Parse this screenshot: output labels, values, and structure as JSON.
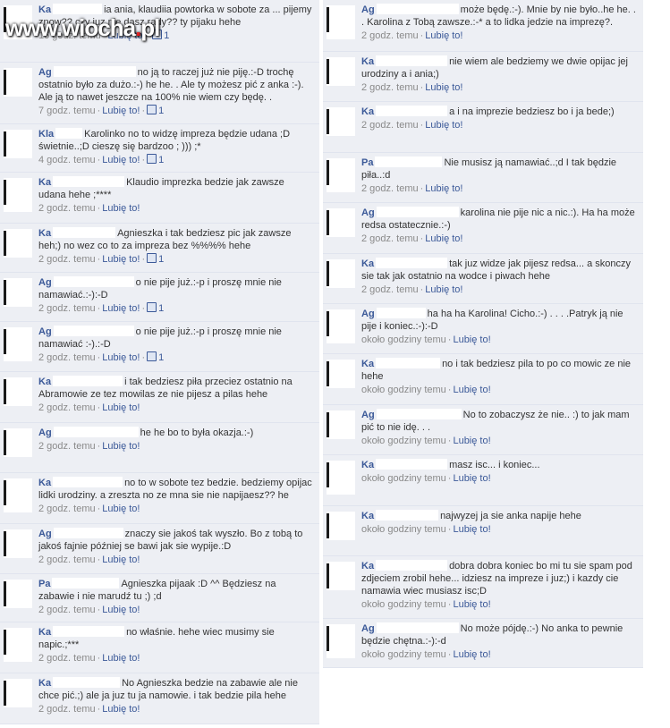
{
  "watermark": {
    "pre": "www.wiocha",
    "dot": ".",
    "tld": "pl"
  },
  "ui": {
    "like": "Lubię to!",
    "separator": "·"
  },
  "left_comments": [
    {
      "name": "Ka",
      "text": "ia ania, klaudiia powtorka w sobote za ... pijemy znow?? czy juz nie dasz rady?? ty pijaku hehe",
      "time": "16 godz. temu",
      "likes": "1"
    },
    {
      "name": "Ag",
      "text": "no ją to raczej już nie piję.:-D trochę ostatnio było za dużo.:-) he he. . Ale ty możesz pić z anka :-). Ale ją to nawet jeszcze na 100% nie wiem czy będę. .",
      "time": "7 godz. temu",
      "likes": "1"
    },
    {
      "name": "Kla",
      "text": "Karolinko no to widzę impreza będzie udana ;D świetnie..;D cieszę się bardzoo ; ))) ;*",
      "time": "4 godz. temu",
      "likes": "1"
    },
    {
      "name": "Ka",
      "text": "Klaudio imprezka bedzie jak zawsze udana hehe ;****",
      "time": "2 godz. temu",
      "likes": ""
    },
    {
      "name": "Ka",
      "text": "Agnieszka i tak bedziesz pic jak zawsze heh;) no wez co to za impreza bez %%%% hehe",
      "time": "2 godz. temu",
      "likes": "1"
    },
    {
      "name": "Ag",
      "text": "o nie pije już.:-p i proszę mnie nie namawiać.:-):-D",
      "time": "2 godz. temu",
      "likes": "1"
    },
    {
      "name": "Ag",
      "text": "o nie pije już.:-p i proszę mnie nie namawiać :-).:-D",
      "time": "2 godz. temu",
      "likes": "1"
    },
    {
      "name": "Ka",
      "text": "i tak bedziesz piła przeciez ostatnio na Abramowie ze tez mowilas ze nie pijesz a pilas hehe",
      "time": "2 godz. temu",
      "likes": ""
    },
    {
      "name": "Ag",
      "text": "he he bo to była okazja.:-)",
      "time": "2 godz. temu",
      "likes": ""
    },
    {
      "name": "Ka",
      "text": "no to w sobote tez bedzie. bedziemy opijac lidki urodziny. a zreszta no ze mna sie nie napijaesz?? he",
      "time": "2 godz. temu",
      "likes": ""
    },
    {
      "name": "Ag",
      "text": "znaczy sie jakoś tak wyszło. Bo z tobą to jakoś fajnie później se bawi jak sie wypije.:D",
      "time": "2 godz. temu",
      "likes": ""
    },
    {
      "name": "Pa",
      "text": "Agnieszka pijaak :D ^^ Będziesz na zabawie i nie marudź tu ;) ;d",
      "time": "2 godz. temu",
      "likes": ""
    },
    {
      "name": "Ka",
      "text": "no właśnie. hehe wiec musimy sie napic.;***",
      "time": "2 godz. temu",
      "likes": ""
    },
    {
      "name": "Ka",
      "text": "No Agnieszka bedzie na zabawie ale nie chce pić.;) ale ja juz tu ja namowie. i tak bedzie pila hehe",
      "time": "2 godz. temu",
      "likes": ""
    }
  ],
  "right_comments": [
    {
      "name": "Ag",
      "text": "może będę.:-). Mnie by nie było..he he. . . Karolina z Tobą zawsze.:-* a to lidka jedzie na imprezę?.",
      "time": "2 godz. temu",
      "likes": ""
    },
    {
      "name": "Ka",
      "text": "nie wiem ale bedziemy we dwie opijac jej urodziny a i ania;)",
      "time": "2 godz. temu",
      "likes": ""
    },
    {
      "name": "Ka",
      "text": "a i na imprezie bedziesz bo i ja bede;)",
      "time": "2 godz. temu",
      "likes": ""
    },
    {
      "name": "Pa",
      "text": "Nie musisz ją namawiać..;d I tak będzie piła..:d",
      "time": "2 godz. temu",
      "likes": ""
    },
    {
      "name": "Ag",
      "text": "karolina nie pije nic a nic.:). Ha ha może redsa ostatecznie.:-)",
      "time": "2 godz. temu",
      "likes": ""
    },
    {
      "name": "Ka",
      "text": "tak juz widze jak pijesz redsa... a skonczy sie tak jak ostatnio na wodce i piwach hehe",
      "time": "2 godz. temu",
      "likes": ""
    },
    {
      "name": "Ag",
      "text": "ha ha ha Karolina! Cicho.:-) . . . .Patryk ją nie pije i koniec.:-):-D",
      "time": "około godziny temu",
      "likes": ""
    },
    {
      "name": "Ka",
      "text": "no i tak bedziesz pila to po co mowic ze nie hehe",
      "time": "około godziny temu",
      "likes": ""
    },
    {
      "name": "Ag",
      "text": "No to zobaczysz że nie.. :) to jak mam pić to nie idę. . .",
      "time": "około godziny temu",
      "likes": ""
    },
    {
      "name": "Ka",
      "text": "masz isc... i koniec...",
      "time": "około godziny temu",
      "likes": ""
    },
    {
      "name": "Ka",
      "text": "najwyzej ja sie anka napije hehe",
      "time": "około godziny temu",
      "likes": ""
    },
    {
      "name": "Ka",
      "text": "dobra dobra koniec bo mi tu sie spam pod zdjeciem zrobil hehe... idziesz na impreze i juz;) i kazdy cie namawia wiec musiasz isc;D",
      "time": "około godziny temu",
      "likes": ""
    },
    {
      "name": "Ag",
      "text": "No może pójdę.:-) No anka to pewnie będzie chętna.:-):-d",
      "time": "około godziny temu",
      "likes": ""
    }
  ]
}
